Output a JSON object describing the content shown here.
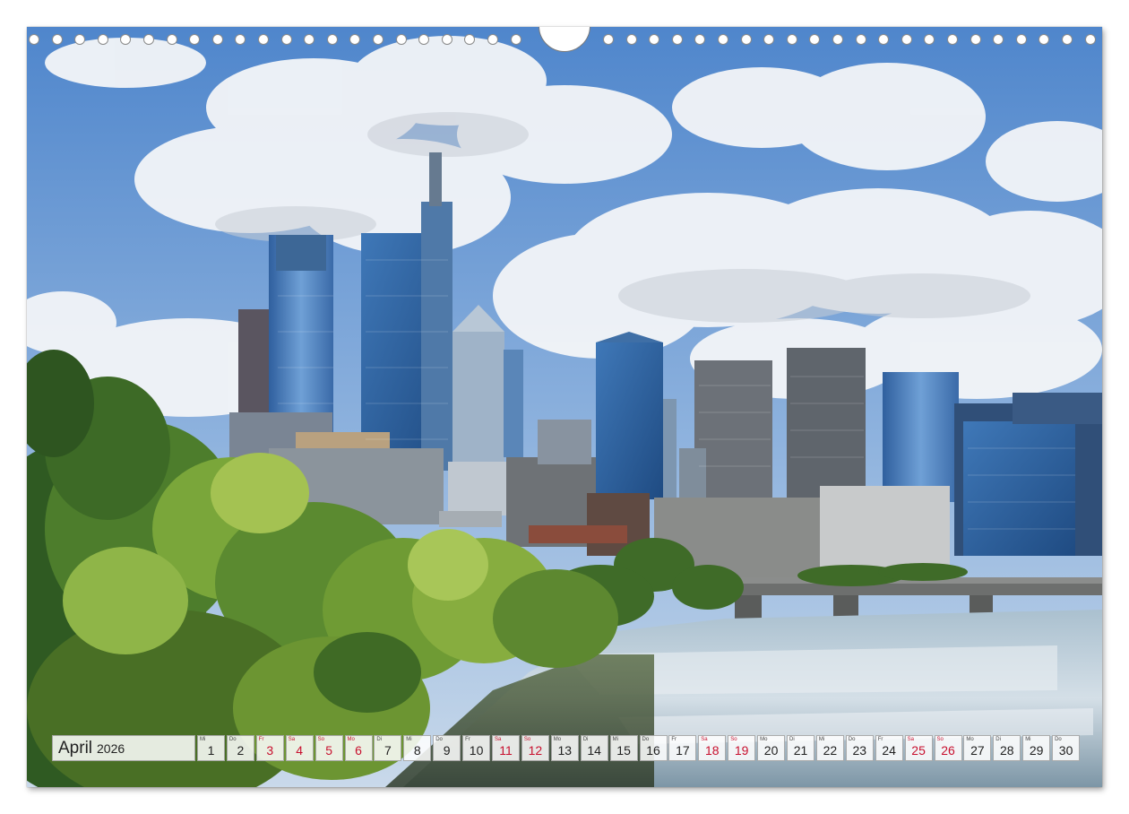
{
  "calendar": {
    "month": "April",
    "year": "2026",
    "days": [
      {
        "wd": "Mi",
        "n": "1",
        "we": false
      },
      {
        "wd": "Do",
        "n": "2",
        "we": false
      },
      {
        "wd": "Fr",
        "n": "3",
        "we": true
      },
      {
        "wd": "Sa",
        "n": "4",
        "we": true
      },
      {
        "wd": "So",
        "n": "5",
        "we": true
      },
      {
        "wd": "Mo",
        "n": "6",
        "we": true
      },
      {
        "wd": "Di",
        "n": "7",
        "we": false
      },
      {
        "wd": "Mi",
        "n": "8",
        "we": false
      },
      {
        "wd": "Do",
        "n": "9",
        "we": false
      },
      {
        "wd": "Fr",
        "n": "10",
        "we": false
      },
      {
        "wd": "Sa",
        "n": "11",
        "we": true
      },
      {
        "wd": "So",
        "n": "12",
        "we": true
      },
      {
        "wd": "Mo",
        "n": "13",
        "we": false
      },
      {
        "wd": "Di",
        "n": "14",
        "we": false
      },
      {
        "wd": "Mi",
        "n": "15",
        "we": false
      },
      {
        "wd": "Do",
        "n": "16",
        "we": false
      },
      {
        "wd": "Fr",
        "n": "17",
        "we": false
      },
      {
        "wd": "Sa",
        "n": "18",
        "we": true
      },
      {
        "wd": "So",
        "n": "19",
        "we": true
      },
      {
        "wd": "Mo",
        "n": "20",
        "we": false
      },
      {
        "wd": "Di",
        "n": "21",
        "we": false
      },
      {
        "wd": "Mi",
        "n": "22",
        "we": false
      },
      {
        "wd": "Do",
        "n": "23",
        "we": false
      },
      {
        "wd": "Fr",
        "n": "24",
        "we": false
      },
      {
        "wd": "Sa",
        "n": "25",
        "we": true
      },
      {
        "wd": "So",
        "n": "26",
        "we": true
      },
      {
        "wd": "Mo",
        "n": "27",
        "we": false
      },
      {
        "wd": "Di",
        "n": "28",
        "we": false
      },
      {
        "wd": "Mi",
        "n": "29",
        "we": false
      },
      {
        "wd": "Do",
        "n": "30",
        "we": false
      }
    ]
  },
  "colors": {
    "sky_top": "#5b8fd1",
    "cloud": "#f2f4f7",
    "tree_light": "#8fb83a",
    "tree_dark": "#2e5e1f",
    "river": "#9fb8c9",
    "weekend_red": "#c8102e"
  }
}
